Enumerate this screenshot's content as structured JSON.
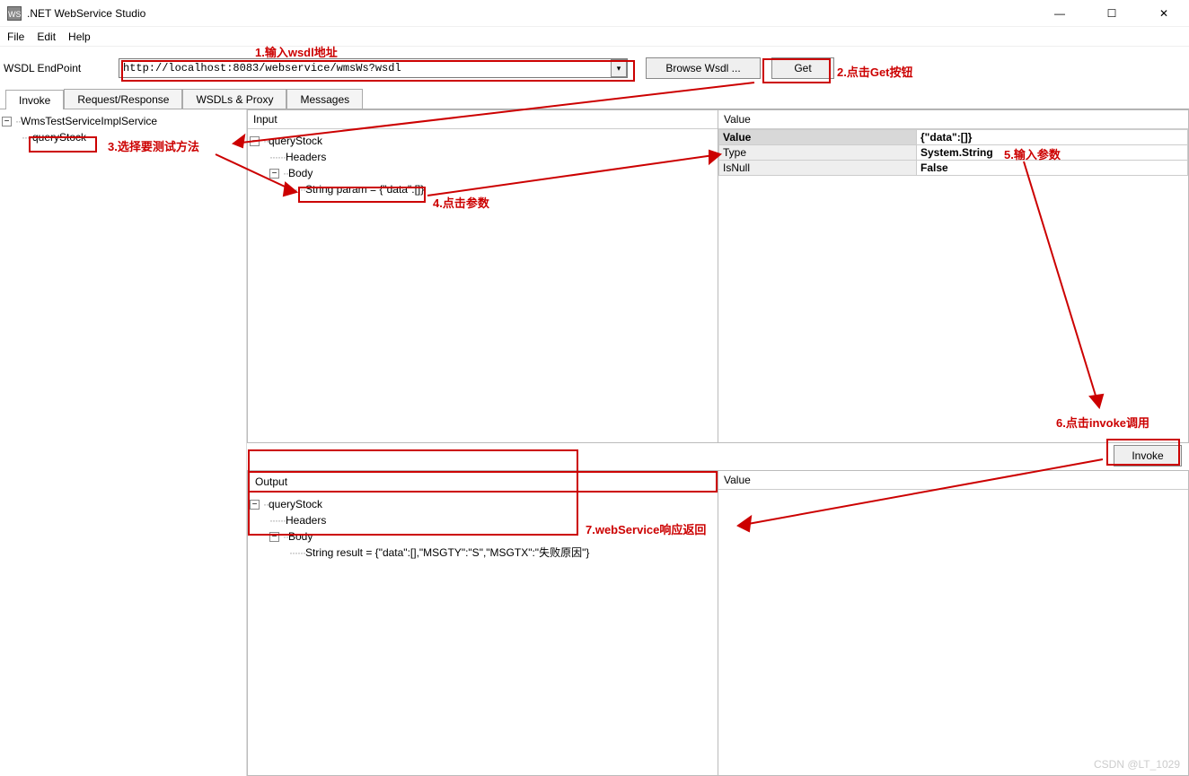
{
  "window": {
    "title": ".NET WebService Studio"
  },
  "menu": {
    "file": "File",
    "edit": "Edit",
    "help": "Help"
  },
  "toolbar": {
    "endpoint_label": "WSDL EndPoint",
    "endpoint_value": "http://localhost:8083/webservice/wmsWs?wsdl",
    "browse_label": "Browse Wsdl ...",
    "get_label": "Get"
  },
  "tabs": {
    "invoke": "Invoke",
    "reqres": "Request/Response",
    "wsdls": "WSDLs & Proxy",
    "messages": "Messages"
  },
  "left_tree": {
    "service": "WmsTestServiceImplService",
    "method": "queryStock"
  },
  "input_panel": {
    "title": "Input",
    "root": "queryStock",
    "headers": "Headers",
    "body": "Body",
    "param": "String param = {\"data\":[]}"
  },
  "value_panel": {
    "title": "Value",
    "rows": {
      "value_k": "Value",
      "value_v": "{\"data\":[]}",
      "type_k": "Type",
      "type_v": "System.String",
      "isnull_k": "IsNull",
      "isnull_v": "False"
    }
  },
  "output_panel": {
    "title": "Output",
    "root": "queryStock",
    "headers": "Headers",
    "body": "Body",
    "result": "String result = {\"data\":[],\"MSGTY\":\"S\",\"MSGTX\":\"失败原因\"}"
  },
  "bottom_value_panel": {
    "title": "Value"
  },
  "invoke_btn": "Invoke",
  "annotations": {
    "a1": "1.输入wsdl地址",
    "a2": "2.点击Get按钮",
    "a3": "3.选择要测试方法",
    "a4": "4.点击参数",
    "a5": "5.输入参数",
    "a6": "6.点击invoke调用",
    "a7": "7.webService响应返回"
  },
  "watermark": "CSDN @LT_1029"
}
